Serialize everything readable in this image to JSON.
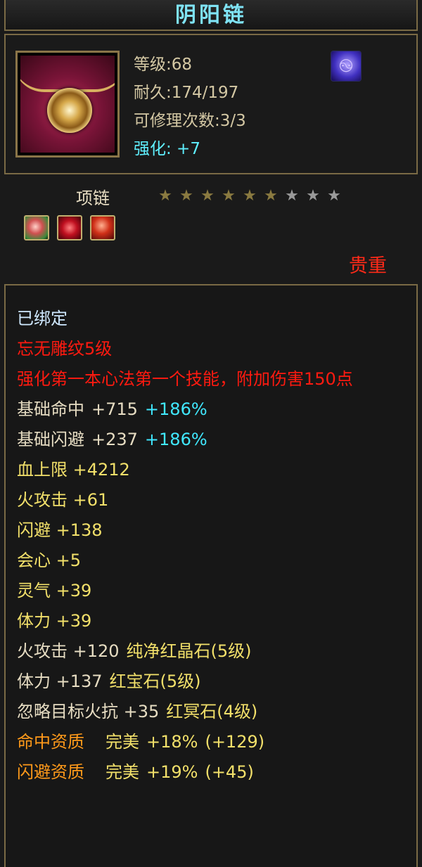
{
  "item": {
    "name": "阴阳链",
    "level": "等级:68",
    "durability": "耐久:174/197",
    "repair": "可修理次数:3/3",
    "enhance": "强化: +7",
    "badge_icon": "swirl-icon",
    "type": "项链",
    "stars": {
      "total": 9,
      "filled": 6
    },
    "gems": [
      "gem-icon",
      "gem-icon",
      "gem-icon"
    ],
    "rarity": "贵重"
  },
  "attributes": {
    "bound": "已绑定",
    "engrave": "忘无雕纹5级",
    "engrave_desc": "强化第一本心法第一个技能，附加伤害150点",
    "base_hit": {
      "label": "基础命中",
      "value": "+715",
      "extra": "+186%"
    },
    "base_dodge": {
      "label": "基础闪避",
      "value": "+237",
      "extra": "+186%"
    },
    "hp": "血上限 +4212",
    "fire_atk": "火攻击 +61",
    "dodge": "闪避 +138",
    "crit": "会心 +5",
    "spirit": "灵气 +39",
    "stamina": "体力 +39",
    "gem_fire": {
      "stat": "火攻击 +120",
      "gem": "纯净红晶石(5级)"
    },
    "gem_stamina": {
      "stat": "体力 +137",
      "gem": "红宝石(5级)"
    },
    "gem_ignore": {
      "stat": "忽略目标火抗 +35",
      "gem": "红冥石(4级)"
    },
    "aptitude_hit": {
      "label": "命中资质",
      "grade": "完美",
      "value": "+18%",
      "bonus": "(+129)"
    },
    "aptitude_dodge": {
      "label": "闪避资质",
      "grade": "完美",
      "value": "+19%",
      "bonus": "(+45)"
    }
  },
  "colors": {
    "title": "#7fe3f5",
    "red": "#ff1a10",
    "cyan": "#40e8ff",
    "yellow": "#f2e06a",
    "orange": "#ff9a1a",
    "border": "#7a6a45"
  }
}
